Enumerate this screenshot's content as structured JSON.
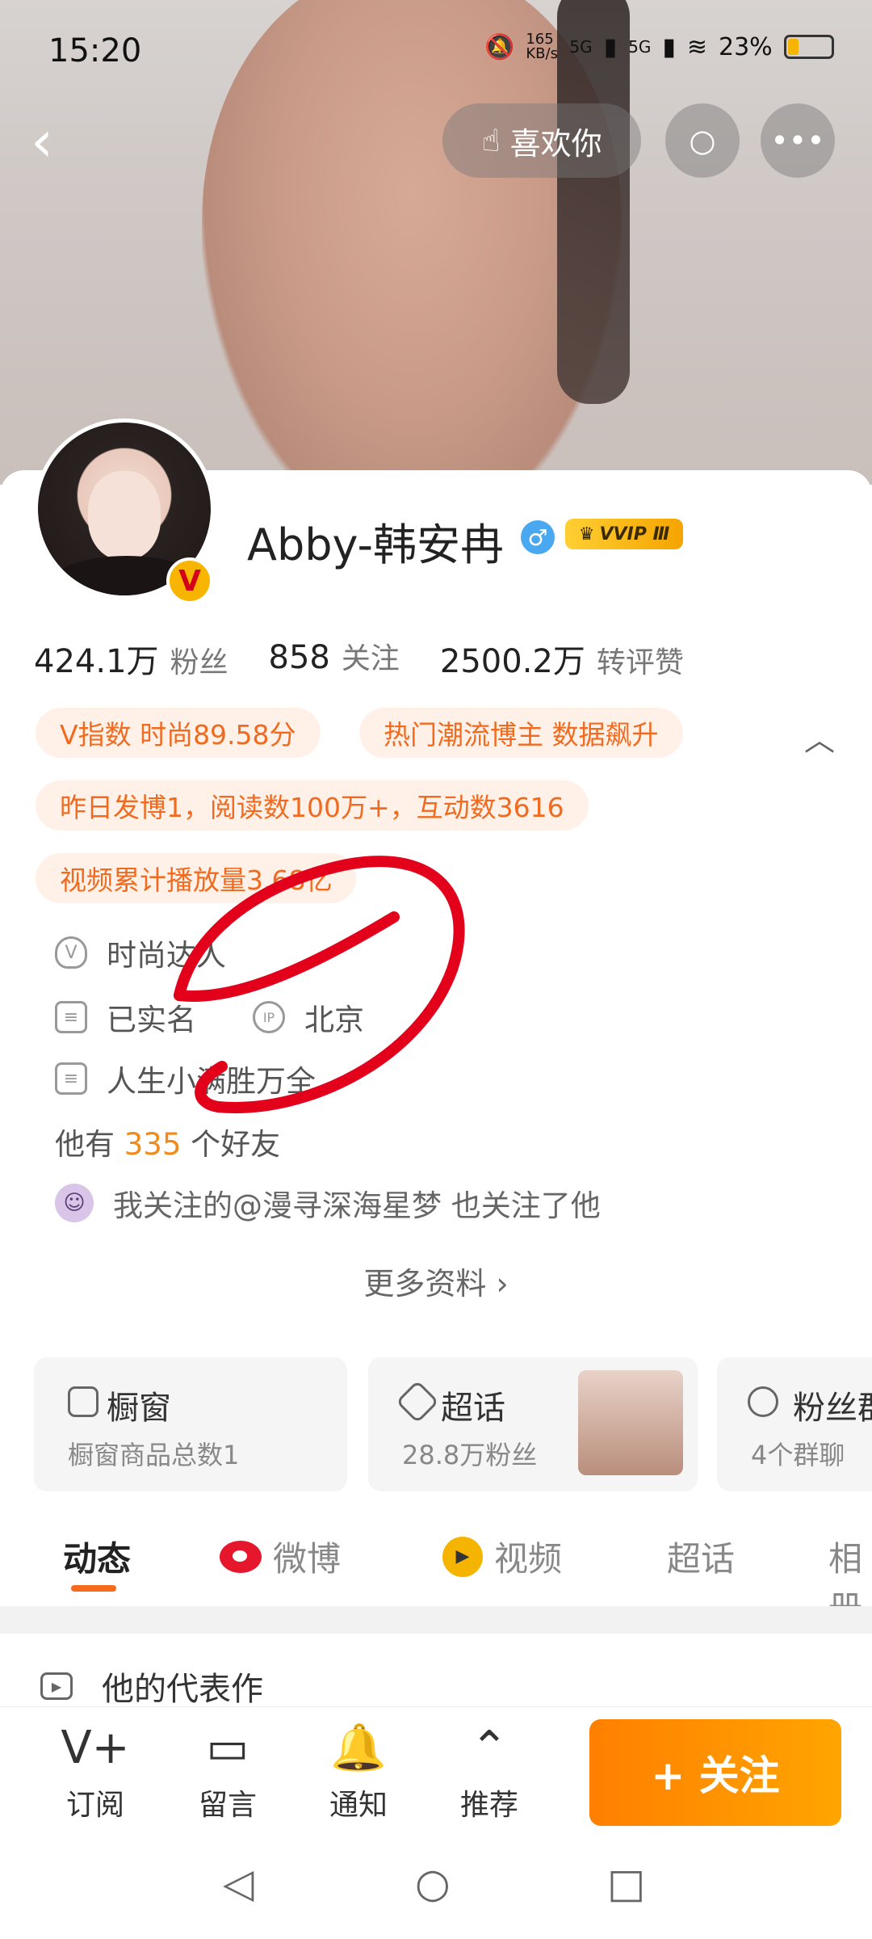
{
  "status_bar": {
    "time": "15:20",
    "net_speed": "165 KB/s",
    "signal_1": "5G",
    "signal_2": "5G",
    "battery": "23%"
  },
  "header": {
    "like_label": "喜欢你"
  },
  "profile": {
    "name": "Abby-韩安冉",
    "vip": "VVIP Ⅲ",
    "stats": [
      {
        "num": "424.1万",
        "label": "粉丝"
      },
      {
        "num": "858",
        "label": "关注"
      },
      {
        "num": "2500.2万",
        "label": "转评赞"
      }
    ],
    "tags": [
      "V指数 时尚89.58分",
      "热门潮流博主 数据飙升",
      "昨日发博1，阅读数100万+，互动数3616",
      "视频累计播放量3.68亿"
    ],
    "info": {
      "title": "时尚达人",
      "verified": "已实名",
      "ip": "IP",
      "location": "北京",
      "bio": "人生小满胜万全"
    },
    "friends": {
      "prefix": "他有",
      "count": "335",
      "suffix": "个好友"
    },
    "mutual": "我关注的@漫寻深海星梦 也关注了他",
    "more": "更多资料 ›"
  },
  "boxes": [
    {
      "title": "橱窗",
      "sub": "橱窗商品总数1"
    },
    {
      "title": "超话",
      "sub": "28.8万粉丝"
    },
    {
      "title": "粉丝群",
      "sub": "4个群聊"
    }
  ],
  "tabs": [
    "动态",
    "微博",
    "视频",
    "超话",
    "相册"
  ],
  "rep_label": "他的代表作",
  "bottom": {
    "items": [
      {
        "label": "订阅"
      },
      {
        "label": "留言"
      },
      {
        "label": "通知"
      },
      {
        "label": "推荐"
      }
    ],
    "follow": "+ 关注"
  }
}
